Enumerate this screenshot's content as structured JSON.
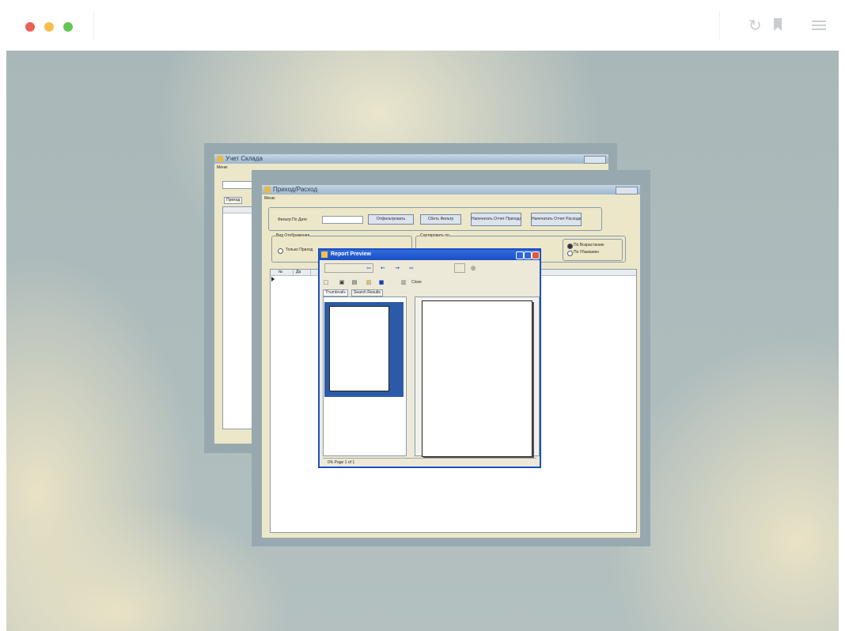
{
  "browser": {
    "dots": [
      "#ec5f58",
      "#f6be4f",
      "#62c655"
    ],
    "icons": [
      "reload-icon",
      "bookmark-icon",
      "menu-icon"
    ]
  },
  "back_window": {
    "title": "Учет Склада",
    "menu_label": "Меню",
    "tab_label": "Приход"
  },
  "front_window": {
    "title": "Приход/Расход",
    "menu_label": "Меню",
    "filter_label": "Фильтр По Дате",
    "buttons": {
      "apply_filter": "Отфильтровать",
      "reset_filter": "Сбить Фильтр",
      "print_income": "Напечатать Отчет Прихода",
      "print_expense": "Напечатать Отчет Расхода"
    },
    "display_group_label": "Вид Отображения",
    "display_option": "Только Приход",
    "sort_group_label": "Сортировать по",
    "sort_asc": "По Возрастанию",
    "sort_desc": "По Убыванию",
    "grid_headers": [
      "№",
      "Да"
    ]
  },
  "report_preview": {
    "title": "Report Preview",
    "tabs": [
      "Thumbnails",
      "Search Results"
    ],
    "close_label": "Close",
    "status": "0%  Page 1 of 1"
  },
  "colors": {
    "xp_blue": "#1c4fc2",
    "classic_beige": "#ece7c8"
  }
}
